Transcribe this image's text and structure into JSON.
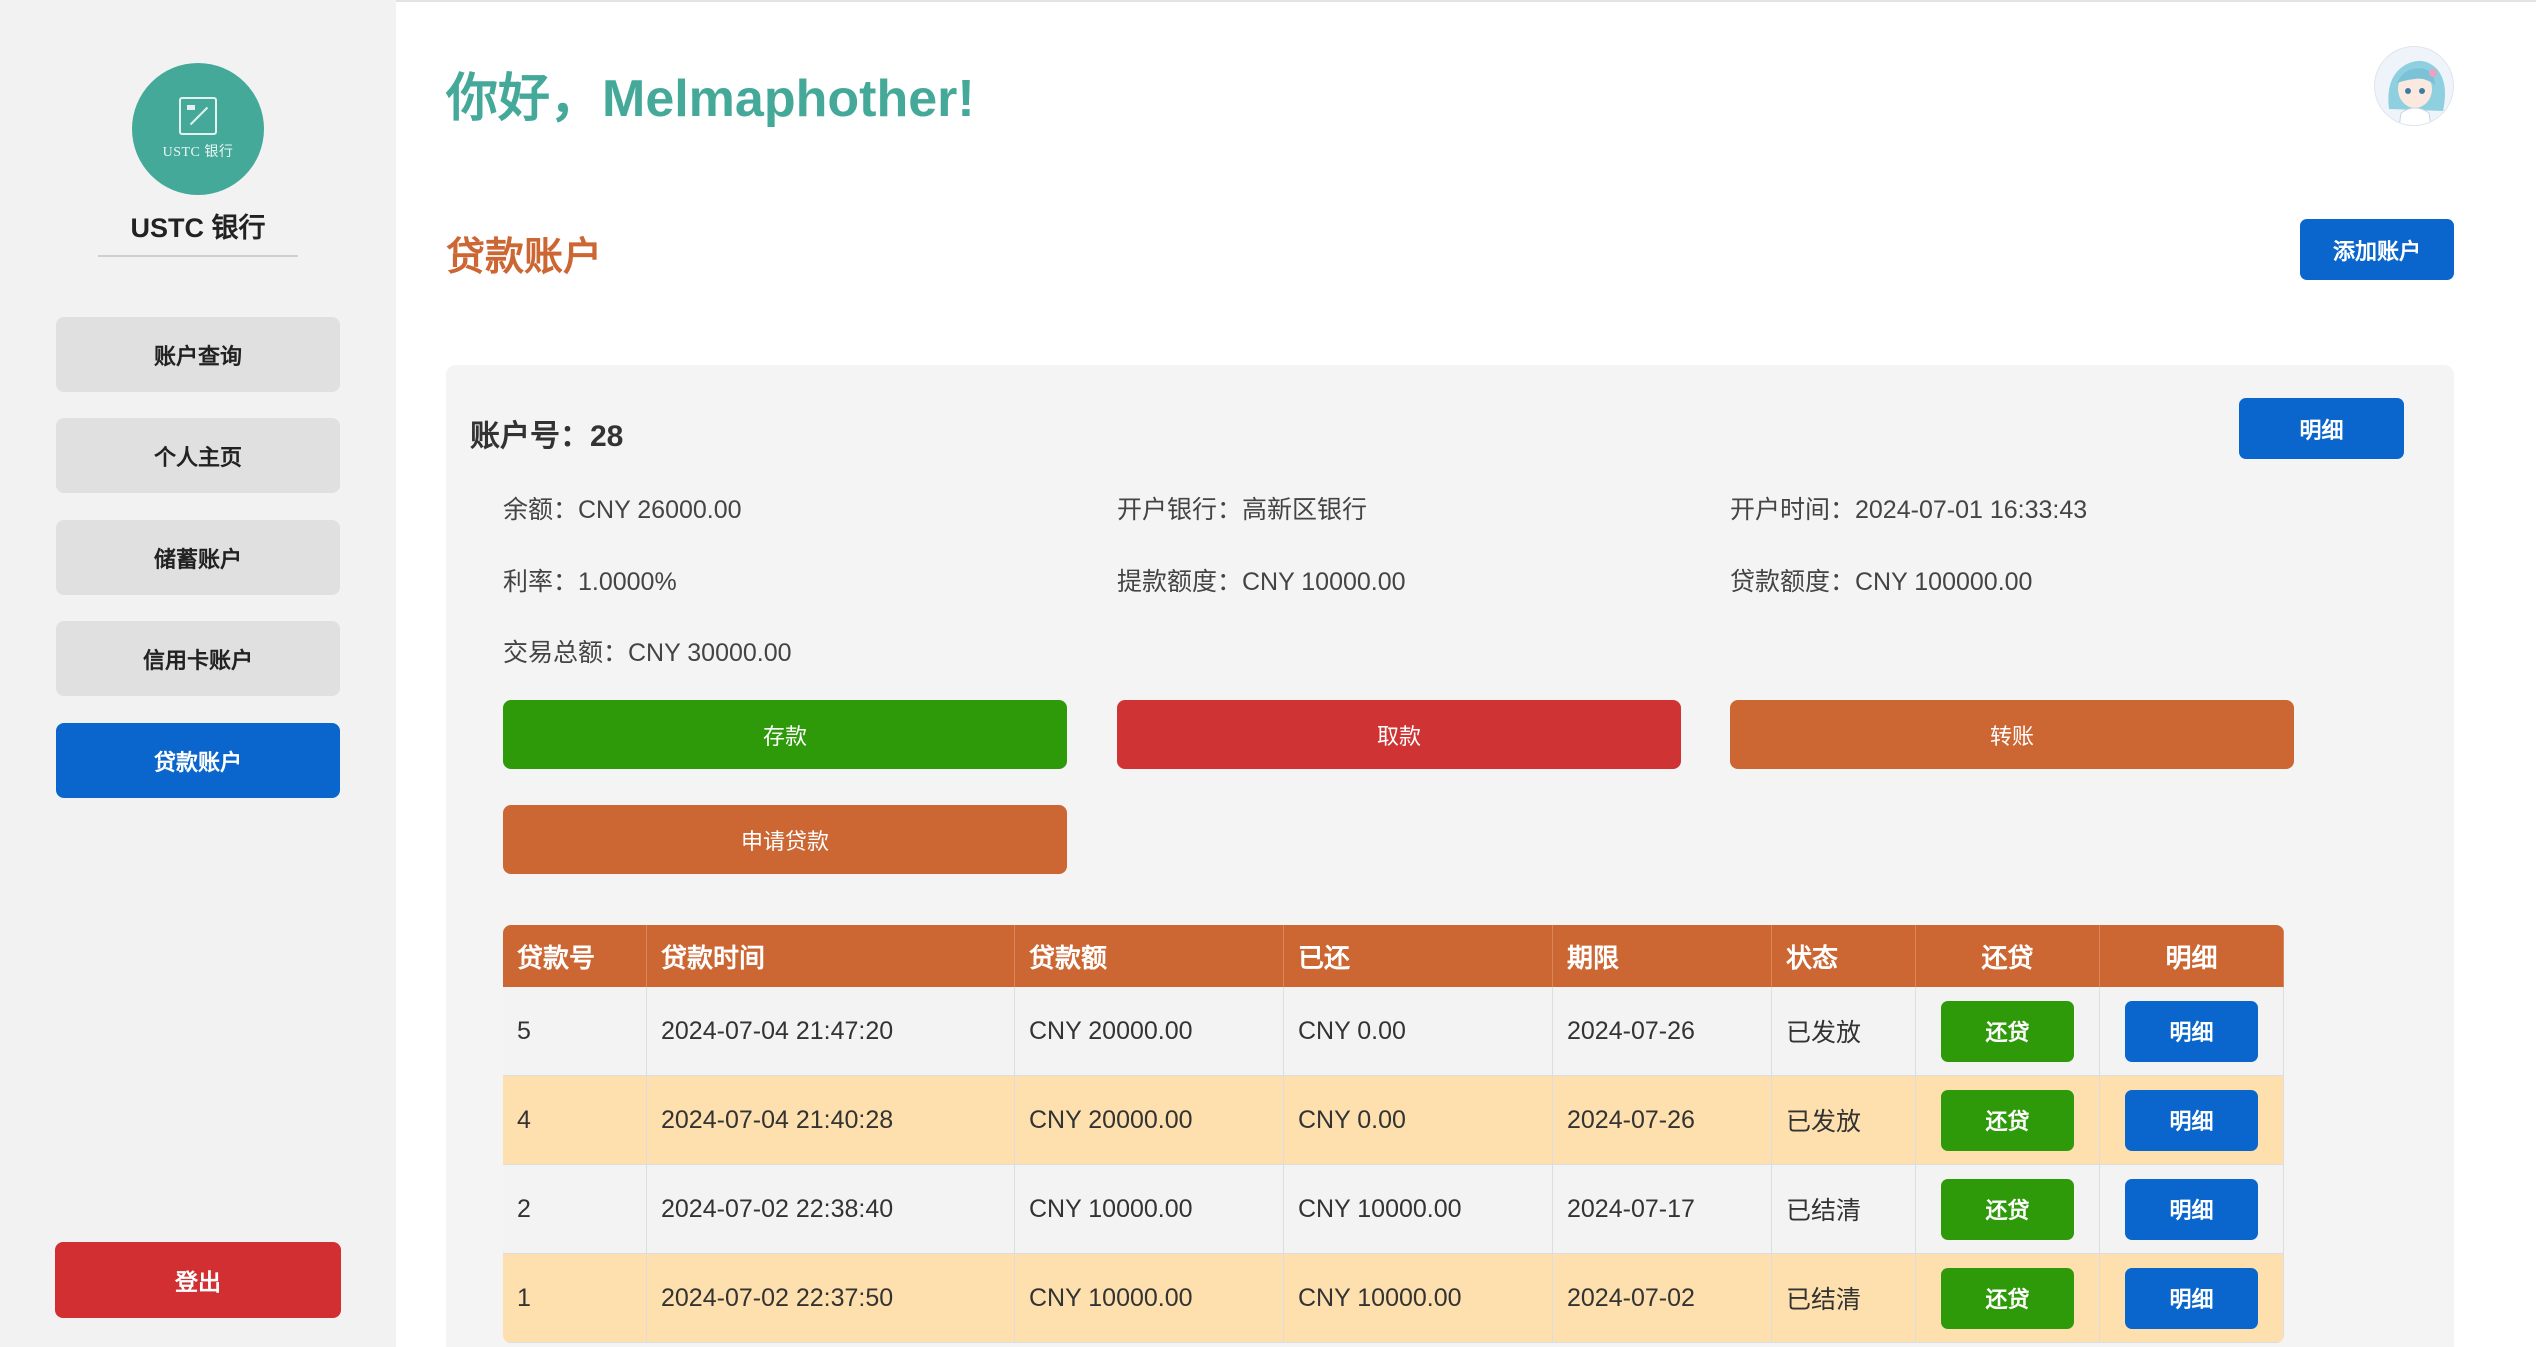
{
  "sidebar": {
    "logo_text": "USTC 银行",
    "bank_name": "USTC 银行",
    "items": [
      {
        "label": "账户查询",
        "active": false
      },
      {
        "label": "个人主页",
        "active": false
      },
      {
        "label": "储蓄账户",
        "active": false
      },
      {
        "label": "信用卡账户",
        "active": false
      },
      {
        "label": "贷款账户",
        "active": true
      }
    ],
    "logout_label": "登出"
  },
  "header": {
    "greeting": "你好，Melmaphother!",
    "avatar_icon": "avatar-icon"
  },
  "section": {
    "title": "贷款账户",
    "add_button": "添加账户"
  },
  "account": {
    "number_label": "账户号：28",
    "detail_button": "明细",
    "balance": "余额：CNY 26000.00",
    "bank": "开户银行：高新区银行",
    "open_time": "开户时间：2024-07-01 16:33:43",
    "interest": "利率：1.0000%",
    "withdraw_limit": "提款额度：CNY 10000.00",
    "loan_limit": "贷款额度：CNY 100000.00",
    "total_transactions": "交易总额：CNY 30000.00",
    "actions": {
      "deposit": "存款",
      "withdraw": "取款",
      "transfer": "转账",
      "apply_loan": "申请贷款"
    },
    "colors": {
      "deposit": "#2f9a09",
      "withdraw": "#cf3333",
      "transfer": "#cc6633",
      "apply_loan": "#cc6633"
    }
  },
  "loans": {
    "headers": [
      "贷款号",
      "贷款时间",
      "贷款额",
      "已还",
      "期限",
      "状态",
      "还贷",
      "明细"
    ],
    "repay_label": "还贷",
    "detail_label": "明细",
    "rows": [
      {
        "id": "5",
        "time": "2024-07-04 21:47:20",
        "amount": "CNY 20000.00",
        "repaid": "CNY 0.00",
        "term": "2024-07-26",
        "status": "已发放"
      },
      {
        "id": "4",
        "time": "2024-07-04 21:40:28",
        "amount": "CNY 20000.00",
        "repaid": "CNY 0.00",
        "term": "2024-07-26",
        "status": "已发放"
      },
      {
        "id": "2",
        "time": "2024-07-02 22:38:40",
        "amount": "CNY 10000.00",
        "repaid": "CNY 10000.00",
        "term": "2024-07-17",
        "status": "已结清"
      },
      {
        "id": "1",
        "time": "2024-07-02 22:37:50",
        "amount": "CNY 10000.00",
        "repaid": "CNY 10000.00",
        "term": "2024-07-02",
        "status": "已结清"
      }
    ]
  },
  "theme": {
    "accent_teal": "#45a99a",
    "accent_orange": "#cc6633",
    "primary_blue": "#0a66cc",
    "danger_red": "#d12f32",
    "success_green": "#2f9a09"
  }
}
